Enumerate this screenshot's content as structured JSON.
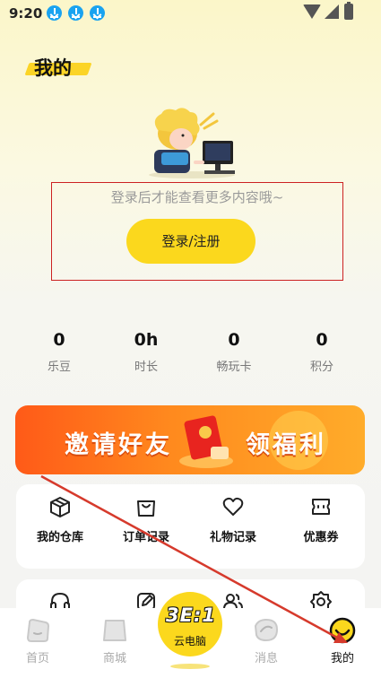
{
  "status_bar": {
    "time": "9:20",
    "icons": [
      "download-icon",
      "download-icon",
      "download-icon",
      "wifi-icon",
      "signal-icon",
      "battery-icon"
    ]
  },
  "header": {
    "title": "我的"
  },
  "login": {
    "prompt": "登录后才能查看更多内容哦~",
    "button_label": "登录/注册"
  },
  "stats": [
    {
      "value": "0",
      "label": "乐豆"
    },
    {
      "value": "0h",
      "label": "时长"
    },
    {
      "value": "0",
      "label": "畅玩卡"
    },
    {
      "value": "0",
      "label": "积分"
    }
  ],
  "banner": {
    "text_left": "邀请好友",
    "text_right": "领福利"
  },
  "menu": [
    {
      "label": "我的仓库",
      "icon": "box-icon"
    },
    {
      "label": "订单记录",
      "icon": "bag-icon"
    },
    {
      "label": "礼物记录",
      "icon": "heart-icon"
    },
    {
      "label": "优惠券",
      "icon": "coupon-icon"
    }
  ],
  "menu2_icons": [
    "headset-icon",
    "edit-icon",
    "users-icon",
    "settings-icon"
  ],
  "tabs": [
    {
      "label": "首页",
      "icon": "home-icon",
      "active": false
    },
    {
      "label": "商城",
      "icon": "mall-icon",
      "active": false
    },
    {
      "label": "云电脑",
      "logo": "3E:1",
      "icon": "cloud-pc-icon",
      "active": false
    },
    {
      "label": "消息",
      "icon": "message-icon",
      "active": false
    },
    {
      "label": "我的",
      "icon": "profile-icon",
      "active": true
    }
  ],
  "colors": {
    "accent_yellow": "#fbd81d",
    "banner_orange": "#ff6a1e",
    "annotation_red": "#cc2222",
    "download_blue": "#1aa3f0"
  }
}
